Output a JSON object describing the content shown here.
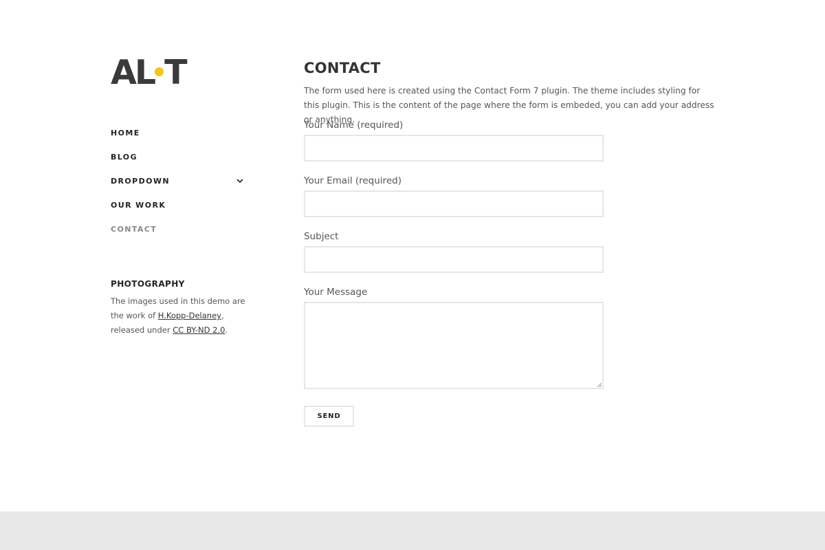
{
  "site": {
    "logo_text_left": "AL",
    "logo_text_right": "T",
    "logo_dot_color": "#f5c518"
  },
  "nav": {
    "items": [
      {
        "label": "HOME"
      },
      {
        "label": "BLOG"
      },
      {
        "label": "DROPDOWN",
        "icon": "chevron-down-icon"
      },
      {
        "label": "OUR WORK"
      },
      {
        "label": "CONTACT",
        "current": true
      }
    ]
  },
  "widget": {
    "title": "PHOTOGRAPHY",
    "text_1": "The images used in this demo are the work of ",
    "link_1": "H.Kopp-Delaney",
    "text_2": ", released under ",
    "link_2": "CC BY-ND 2.0",
    "text_3": "."
  },
  "page": {
    "title": "CONTACT",
    "intro": "The form used here is created using the Contact Form 7 plugin. The theme includes styling for this plugin. This is the content of the page where the form is embeded, you can add your address or anything."
  },
  "form": {
    "name_label": "Your Name (required)",
    "name_value": "",
    "email_label": "Your Email (required)",
    "email_value": "",
    "subject_label": "Subject",
    "subject_value": "",
    "message_label": "Your Message",
    "message_value": "",
    "send_label": "SEND"
  },
  "colors": {
    "accent": "#f5c518",
    "footer_bg": "#e8e8e8",
    "border": "#e6e6e6"
  }
}
